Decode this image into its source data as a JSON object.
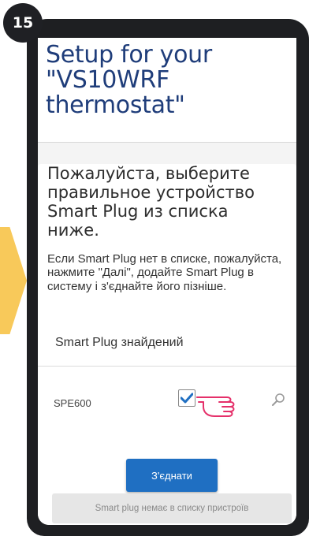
{
  "step_badge": "15",
  "header": {
    "title": "Setup for your \"VS10WRF thermostat\""
  },
  "instruction": "Пожалуйста, выберите правильное устройство Smart Plug из списка ниже.",
  "note": "Если Smart Plug нет в списке, пожалуйста, нажмите \"Далі\", додайте Smart Plug в систему і з'єднайте його пізніше.",
  "list": {
    "header": "Smart Plug знайдений",
    "devices": [
      {
        "name": "SPE600",
        "checked": true
      }
    ]
  },
  "buttons": {
    "connect": "З'єднати",
    "not_listed": "Smart plug немає в списку пристроїв"
  },
  "icons": {
    "checkbox": "checkmark-icon",
    "pointer": "pointing-hand-icon",
    "search": "search-icon"
  },
  "colors": {
    "title": "#1f3d7a",
    "primary_button": "#1f6fc2",
    "checkmark": "#1f6fc2",
    "hand": "#e5306a",
    "arrow": "#f8c95a"
  }
}
